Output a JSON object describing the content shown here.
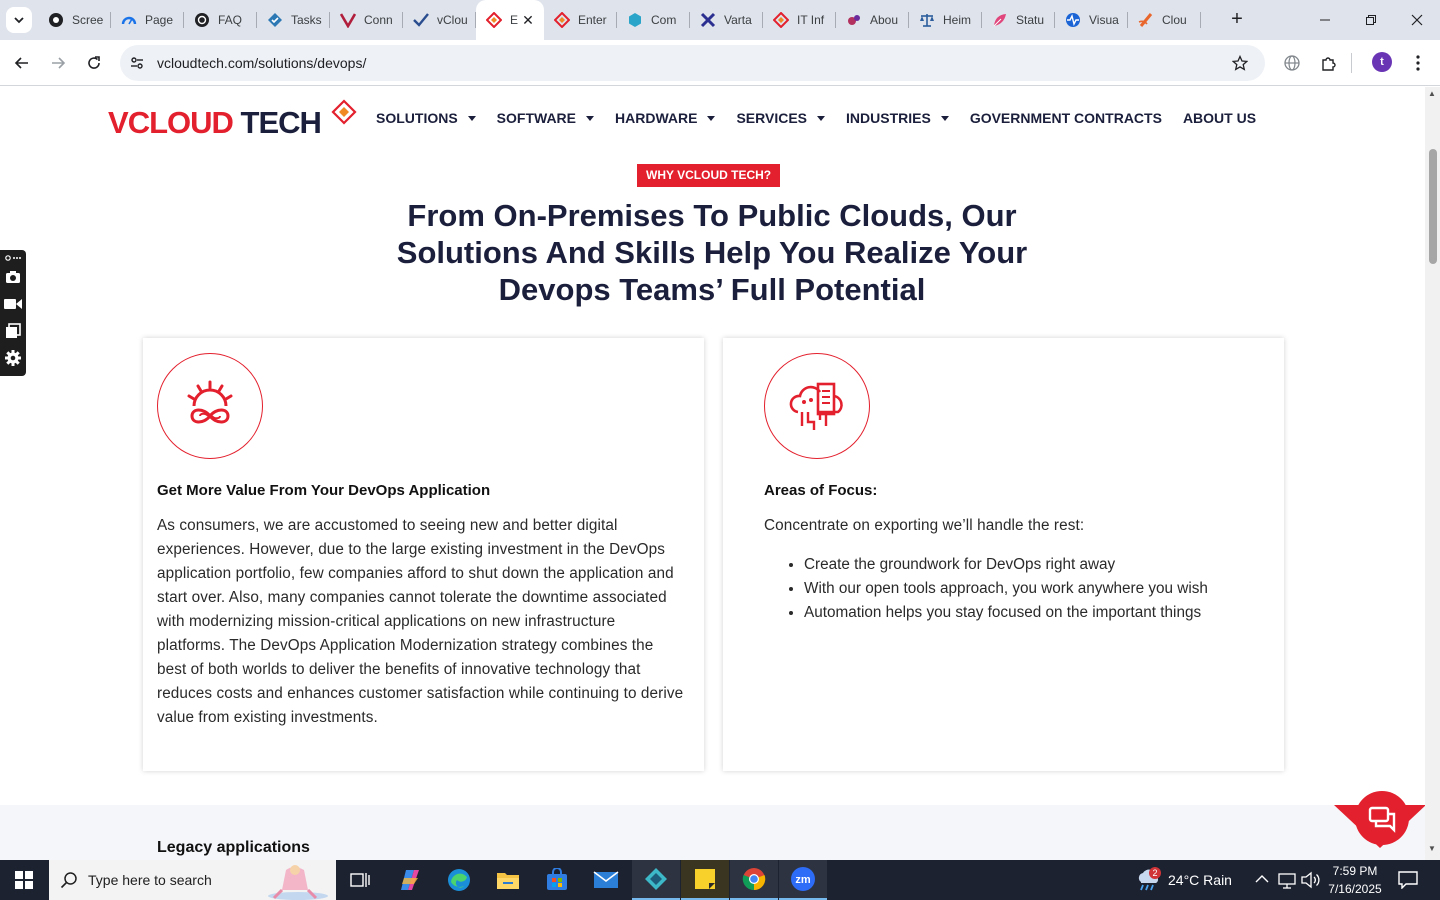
{
  "browser": {
    "tabs": [
      {
        "label": "Scree",
        "icon": "camera-lens-icon"
      },
      {
        "label": "Page",
        "icon": "gauge-icon"
      },
      {
        "label": "FAQ",
        "icon": "openai-icon"
      },
      {
        "label": "Tasks",
        "icon": "tasks-icon"
      },
      {
        "label": "Conn",
        "icon": "v-logo-icon"
      },
      {
        "label": "vClou",
        "icon": "check-logo-icon"
      },
      {
        "label": "E",
        "icon": "vcloud-diamond-icon",
        "active": true
      },
      {
        "label": "Enter",
        "icon": "vcloud-diamond-icon"
      },
      {
        "label": "Com",
        "icon": "hexagon-icon"
      },
      {
        "label": "Varta",
        "icon": "x-logo-icon"
      },
      {
        "label": "IT Inf",
        "icon": "vcloud-diamond-icon"
      },
      {
        "label": "Abou",
        "icon": "abstract-logo-icon"
      },
      {
        "label": "Heim",
        "icon": "scales-icon"
      },
      {
        "label": "Statu",
        "icon": "leaf-logo-icon"
      },
      {
        "label": "Visua",
        "icon": "pulse-icon"
      },
      {
        "label": "Clou",
        "icon": "slash-logo-icon"
      }
    ],
    "url": "vcloudtech.com/solutions/devops/",
    "profile_initial": "t"
  },
  "site": {
    "logo": {
      "v": "V",
      "rest": "CLOUD ",
      "tech": "TECH"
    },
    "nav": [
      {
        "label": "SOLUTIONS",
        "dropdown": true
      },
      {
        "label": "SOFTWARE",
        "dropdown": true
      },
      {
        "label": "HARDWARE",
        "dropdown": true
      },
      {
        "label": "SERVICES",
        "dropdown": true
      },
      {
        "label": "INDUSTRIES",
        "dropdown": true
      },
      {
        "label": "GOVERNMENT CONTRACTS",
        "dropdown": false
      },
      {
        "label": "ABOUT US",
        "dropdown": false
      }
    ],
    "badge": "WHY VCLOUD TECH?",
    "headline": "From On-Premises To Public Clouds, Our Solutions And Skills Help You Realize Your Devops Teams’ Full Potential",
    "card_left": {
      "icon": "gear-infinity-icon",
      "title": "Get More Value From Your DevOps Application",
      "body": "As consumers, we are accustomed to seeing new and better digital experiences. However, due to the large existing investment in the DevOps application portfolio, few companies afford to shut down the application and start over. Also, many companies cannot tolerate the downtime associated with modernizing mission-critical applications on new infrastructure platforms. The DevOps Application Modernization strategy combines the best of both worlds to deliver the benefits of innovative technology that reduces costs and enhances customer satisfaction while continuing to derive value from existing investments."
    },
    "card_right": {
      "icon": "cloud-server-icon",
      "title": "Areas of Focus:",
      "intro": "Concentrate on exporting we’ll handle the rest:",
      "bullets": [
        "Create the groundwork for DevOps right away",
        "With our open tools approach, you work anywhere you wish",
        "Automation helps you stay focused on the important things"
      ]
    },
    "next_section_title": "Legacy applications"
  },
  "taskbar": {
    "search_placeholder": "Type here to search",
    "weather": "24°C  Rain",
    "weather_badge": "2",
    "time": "7:59 PM",
    "date": "7/16/2025"
  },
  "colors": {
    "brand_red": "#e3202d",
    "brand_navy": "#1b1f3b"
  }
}
